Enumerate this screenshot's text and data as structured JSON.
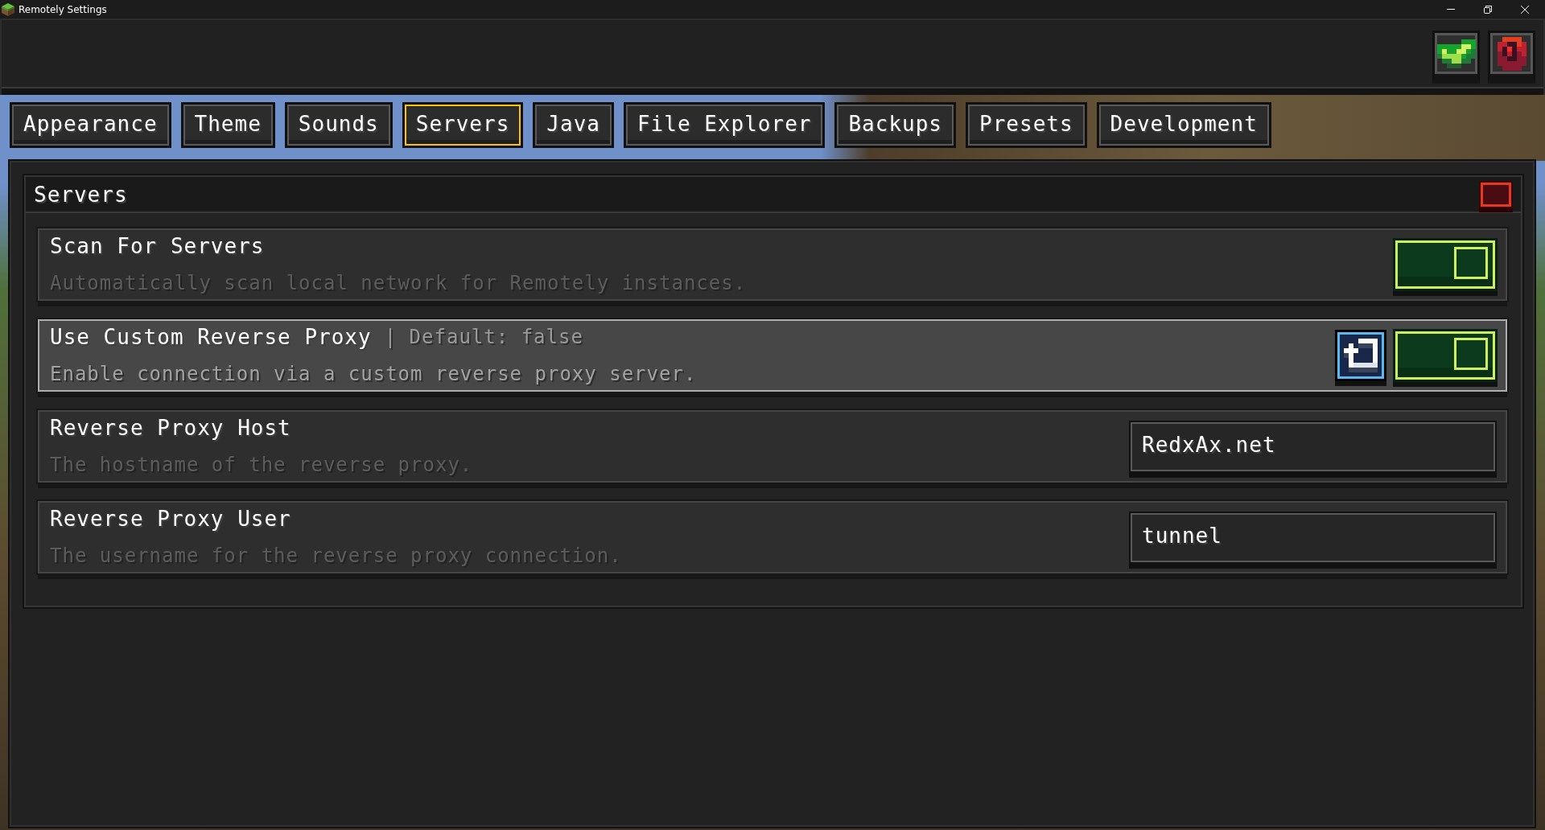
{
  "window": {
    "title": "Remotely Settings"
  },
  "header_buttons": [
    {
      "kind": "confirm"
    },
    {
      "kind": "cancel"
    }
  ],
  "tabs": [
    {
      "label": "Appearance",
      "selected": false
    },
    {
      "label": "Theme",
      "selected": false
    },
    {
      "label": "Sounds",
      "selected": false
    },
    {
      "label": "Servers",
      "selected": true
    },
    {
      "label": "Java",
      "selected": false
    },
    {
      "label": "File Explorer",
      "selected": false
    },
    {
      "label": "Backups",
      "selected": false
    },
    {
      "label": "Presets",
      "selected": false
    },
    {
      "label": "Development",
      "selected": false
    }
  ],
  "section": {
    "title": "Servers",
    "settings": [
      {
        "kind": "toggle",
        "title": "Scan For Servers",
        "description": "Automatically scan local network for Remotely instances.",
        "on": true,
        "hovered": false,
        "modified": false
      },
      {
        "kind": "toggle",
        "title": "Use Custom Reverse Proxy",
        "default_note": "| Default: false",
        "description": "Enable connection via a custom reverse proxy server.",
        "on": true,
        "hovered": true,
        "modified": true
      },
      {
        "kind": "text",
        "title": "Reverse Proxy Host",
        "description": "The hostname of the reverse proxy.",
        "value": "RedxAx.net",
        "hovered": false,
        "modified": false
      },
      {
        "kind": "text",
        "title": "Reverse Proxy User",
        "description": "The username for the reverse proxy connection.",
        "value": "tunnel",
        "hovered": false,
        "modified": false
      }
    ]
  }
}
